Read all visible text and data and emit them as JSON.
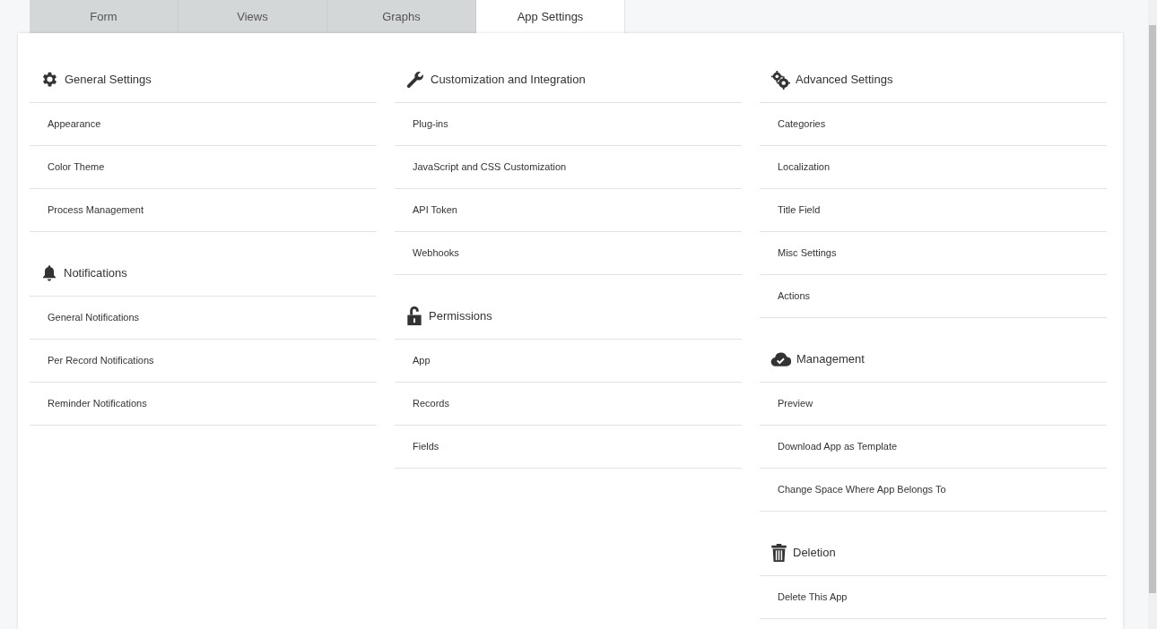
{
  "tabs": [
    {
      "label": "Form",
      "selected": false
    },
    {
      "label": "Views",
      "selected": false
    },
    {
      "label": "Graphs",
      "selected": false
    },
    {
      "label": "App Settings",
      "selected": true
    }
  ],
  "columns": [
    {
      "sections": [
        {
          "kind": "gear",
          "title": "General Settings",
          "items": [
            "Appearance",
            "Color Theme",
            "Process Management"
          ]
        },
        {
          "kind": "bell",
          "title": "Notifications",
          "items": [
            "General Notifications",
            "Per Record Notifications",
            "Reminder Notifications"
          ]
        }
      ]
    },
    {
      "sections": [
        {
          "kind": "wrench",
          "title": "Customization and Integration",
          "items": [
            "Plug-ins",
            "JavaScript and CSS Customization",
            "API Token",
            "Webhooks"
          ]
        },
        {
          "kind": "lock",
          "title": "Permissions",
          "items": [
            "App",
            "Records",
            "Fields"
          ]
        }
      ]
    },
    {
      "sections": [
        {
          "kind": "gears",
          "title": "Advanced Settings",
          "items": [
            "Categories",
            "Localization",
            "Title Field",
            "Misc Settings",
            "Actions"
          ]
        },
        {
          "kind": "cloud",
          "title": "Management",
          "items": [
            "Preview",
            "Download App as Template",
            "Change Space Where App Belongs To"
          ]
        },
        {
          "kind": "trash",
          "title": "Deletion",
          "items": [
            "Delete This App"
          ]
        }
      ]
    }
  ]
}
